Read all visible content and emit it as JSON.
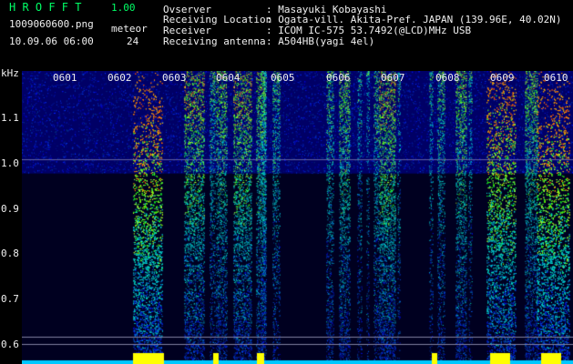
{
  "header": {
    "app_name": "H R O F F T",
    "version": "1.00",
    "filename": "1009060600.png",
    "datetime": "10.09.06 06:00",
    "meteor_label": "meteor",
    "meteor_count": "24"
  },
  "info": {
    "labels": [
      "Ovserver",
      "Receiving Location",
      "Receiver",
      "Receiving antenna"
    ],
    "values": [
      ": Masayuki Kobayashi",
      ": Ogata-vill. Akita-Pref. JAPAN (139.96E, 40.02N)",
      ": ICOM IC-575 53.7492(@LCD)MHz USB",
      ": A504HB(yagi 4el)"
    ]
  },
  "spectrogram": {
    "y_unit": "kHz",
    "y_ticks": [
      "1.1",
      "1.0",
      "0.9",
      "0.8",
      "0.7",
      "0.6"
    ],
    "time_labels": [
      "0601",
      "0602",
      "0603",
      "0604",
      "0605",
      "0606",
      "0607",
      "0608",
      "0609",
      "0610"
    ],
    "colors": {
      "background": "#000066",
      "text": "#f0f0f0",
      "accent": "#00ff00",
      "meteor_trace": "#ffff00"
    }
  }
}
